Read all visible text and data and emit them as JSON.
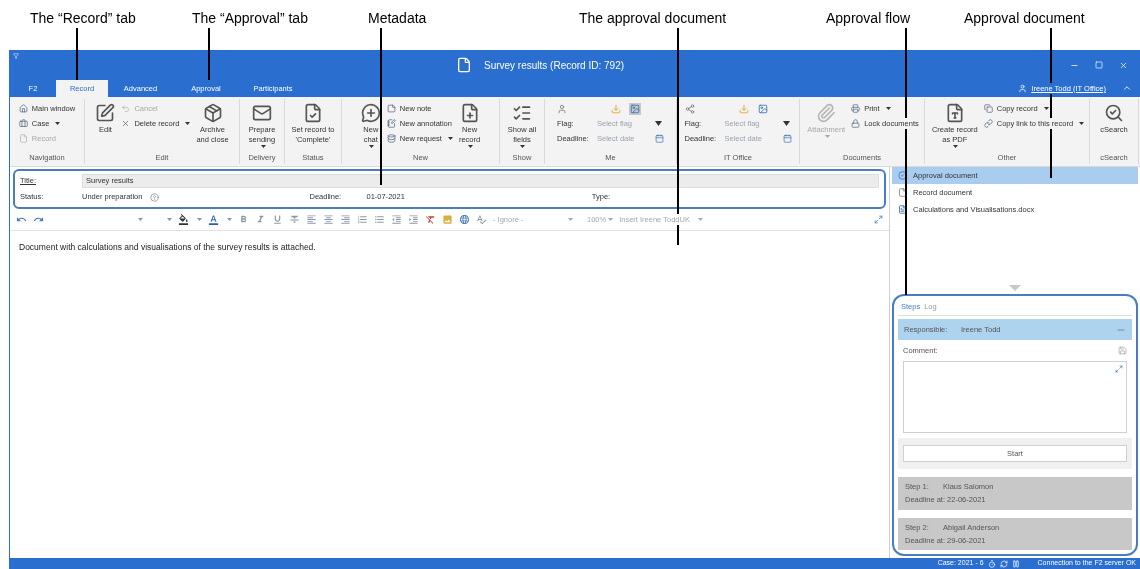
{
  "callouts": [
    {
      "text": "The “Record” tab"
    },
    {
      "text": "The “Approval” tab"
    },
    {
      "text": "Metadata"
    },
    {
      "text": "The approval document"
    },
    {
      "text": "Approval flow"
    },
    {
      "text": "Approval document"
    }
  ],
  "window": {
    "title": "Survey results (Record ID: 792)",
    "user": "Ireene Todd (IT Office)"
  },
  "tabs": [
    {
      "label": "F2",
      "selected": false
    },
    {
      "label": "Record",
      "selected": true
    },
    {
      "label": "Advanced",
      "selected": false
    },
    {
      "label": "Approval",
      "selected": false
    },
    {
      "label": "Participants",
      "selected": false
    }
  ],
  "ribbon": [
    {
      "label": "Navigation",
      "columns": [
        [
          {
            "kind": "small",
            "label": "Main window",
            "dropdown": false,
            "disabled": false
          },
          {
            "kind": "small",
            "label": "Case",
            "dropdown": true,
            "disabled": false
          },
          {
            "kind": "small",
            "label": "Record",
            "dropdown": false,
            "disabled": true
          }
        ]
      ]
    },
    {
      "label": "Edit",
      "columns": [
        [
          {
            "kind": "large",
            "label": "Edit",
            "dropdown": false,
            "disabled": false
          }
        ],
        [
          {
            "kind": "small",
            "label": "Cancel",
            "dropdown": false,
            "disabled": true
          },
          {
            "kind": "small",
            "label": "Delete record",
            "dropdown": true,
            "disabled": false
          }
        ],
        [
          {
            "kind": "large",
            "label": "Archive\nand close",
            "dropdown": false,
            "disabled": false
          }
        ]
      ]
    },
    {
      "label": "Delivery",
      "columns": [
        [
          {
            "kind": "large",
            "label": "Prepare\nsending",
            "dropdown": true,
            "disabled": false
          }
        ]
      ]
    },
    {
      "label": "Status",
      "columns": [
        [
          {
            "kind": "large",
            "label": "Set record to\n'Complete'",
            "dropdown": false,
            "disabled": false
          }
        ]
      ]
    },
    {
      "label": "New",
      "columns": [
        [
          {
            "kind": "large",
            "label": "New\nchat",
            "dropdown": true,
            "disabled": false
          }
        ],
        [
          {
            "kind": "small",
            "label": "New note",
            "dropdown": false,
            "disabled": false
          },
          {
            "kind": "small",
            "label": "New annotation",
            "dropdown": false,
            "disabled": false
          },
          {
            "kind": "small",
            "label": "New request",
            "dropdown": true,
            "disabled": false
          }
        ],
        [
          {
            "kind": "large",
            "label": "New\nrecord",
            "dropdown": true,
            "disabled": false
          }
        ]
      ]
    },
    {
      "label": "Show",
      "columns": [
        [
          {
            "kind": "large",
            "label": "Show all\nfields",
            "dropdown": true,
            "disabled": false
          }
        ]
      ]
    },
    {
      "label": "Me",
      "columns": [
        [
          {
            "kind": "icons",
            "selected": true
          },
          {
            "kind": "field",
            "label": "Flag:",
            "placeholder": "Select flag"
          },
          {
            "kind": "field",
            "label": "Deadline:",
            "placeholder": "Select date"
          }
        ]
      ]
    },
    {
      "label": "IT Office",
      "columns": [
        [
          {
            "kind": "icons",
            "selected": false
          },
          {
            "kind": "field",
            "label": "Flag:",
            "placeholder": "Select flag"
          },
          {
            "kind": "field",
            "label": "Deadline:",
            "placeholder": "Select date"
          }
        ]
      ]
    },
    {
      "label": "Documents",
      "columns": [
        [
          {
            "kind": "large",
            "label": "Attachment",
            "dropdown": true,
            "disabled": true
          }
        ],
        [
          {
            "kind": "small",
            "label": "Print",
            "dropdown": true,
            "disabled": false
          },
          {
            "kind": "small",
            "label": "Lock documents",
            "dropdown": false,
            "disabled": false
          }
        ]
      ]
    },
    {
      "label": "Other",
      "columns": [
        [
          {
            "kind": "large",
            "label": "Create record\nas PDF",
            "dropdown": true,
            "disabled": false
          }
        ],
        [
          {
            "kind": "small",
            "label": "Copy record",
            "dropdown": true,
            "disabled": false
          },
          {
            "kind": "small",
            "label": "Copy link to this record",
            "dropdown": true,
            "disabled": false
          }
        ]
      ]
    },
    {
      "label": "cSearch",
      "columns": [
        [
          {
            "kind": "large",
            "label": "cSearch",
            "dropdown": false,
            "disabled": false
          }
        ]
      ]
    }
  ],
  "metadata": {
    "title": {
      "label": "Title:",
      "value": "Survey results"
    },
    "status": {
      "label": "Status:",
      "value": "Under preparation"
    },
    "deadline": {
      "label": "Deadline:",
      "value": "01-07-2021"
    },
    "type": {
      "label": "Type:"
    }
  },
  "editor_toolbar": {
    "language": "- Ignore -",
    "zoom": "100%",
    "insert": "Insert Ireene ToddUK"
  },
  "document_text": "Document with calculations and visualisations of the survey results is attached.",
  "documents": [
    {
      "name": "Approval document",
      "kind": "approval",
      "selected": true
    },
    {
      "name": "Record document",
      "kind": "record",
      "selected": false
    },
    {
      "name": "Calculations and Visualisations.docx",
      "kind": "word",
      "selected": false
    }
  ],
  "approval_flow": {
    "tabs": [
      {
        "label": "Steps",
        "selected": true
      },
      {
        "label": "Log",
        "selected": false
      }
    ],
    "responsible": {
      "label": "Responsible:",
      "value": "Ireene Todd"
    },
    "comment_label": "Comment:",
    "start_button": "Start",
    "steps": [
      {
        "label": "Step 1:",
        "name": "Klaus Salomon",
        "deadline": "Deadline at: 22-06-2021"
      },
      {
        "label": "Step 2:",
        "name": "Abigail Anderson",
        "deadline": "Deadline at: 29-06-2021"
      }
    ]
  },
  "status_bar": {
    "case": "Case: 2021 - 6",
    "connection": "Connection to the F2 server OK"
  }
}
